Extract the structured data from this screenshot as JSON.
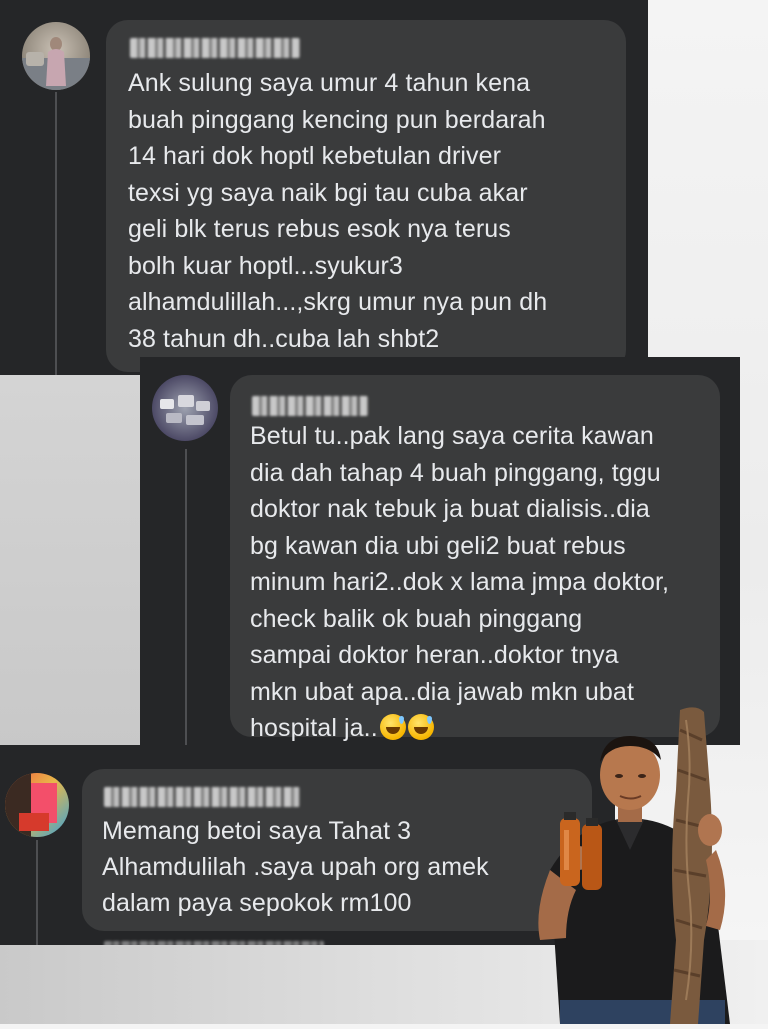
{
  "comments": [
    {
      "id": "comment-1",
      "author": "",
      "text": "Ank sulung saya umur 4 tahun kena\nbuah pinggang kencing pun berdarah\n14 hari dok hoptl kebetulan driver\ntexsi yg saya naik bgi tau cuba akar\ngeli blk terus rebus esok nya terus\nbolh kuar hoptl...syukur3\nalhamdulillah...,skrg umur nya pun dh\n38 tahun dh..cuba lah shbt2"
    },
    {
      "id": "comment-2",
      "author": "",
      "text": "Betul tu..pak lang saya cerita kawan\ndia dah tahap 4 buah pinggang, tggu\ndoktor nak tebuk ja buat dialisis..dia\nbg kawan dia ubi geli2 buat rebus\nminum hari2..dok x lama jmpa doktor,\ncheck balik ok buah pinggang\nsampai doktor heran..doktor tnya\nmkn ubat apa..dia jawab mkn ubat\nhospital ja..",
      "emoji": "grinning-sweat-emoji"
    },
    {
      "id": "comment-3",
      "author": "",
      "text": "Memang betoi saya Tahat 3\nAlhamdulilah .saya upah org amek\ndalam paya sepokok  rm100"
    }
  ],
  "colors": {
    "panel": "#252628",
    "bubble": "#3a3b3c",
    "text": "#e7e9ec"
  }
}
